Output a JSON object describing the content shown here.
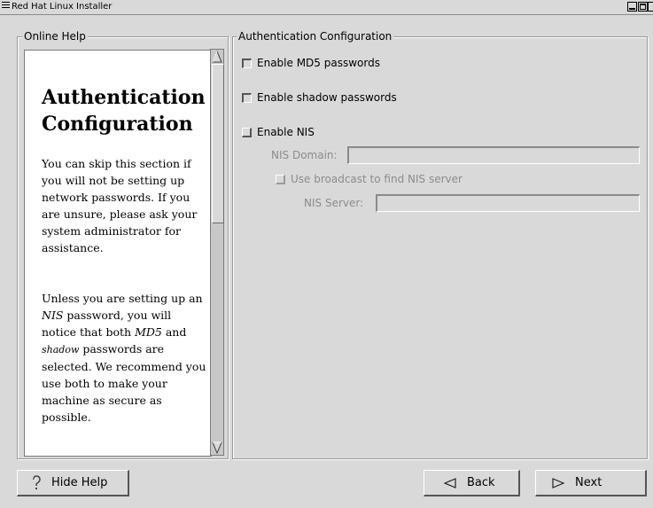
{
  "window": {
    "title": "Red Hat Linux Installer"
  },
  "help": {
    "frame_label": "Online Help",
    "heading": "Authentication Configuration",
    "para1": "You can skip this section if you will not be setting up network passwords. If you are unsure, please ask your system administrator for assistance.",
    "para2_a": "Unless you are setting up an ",
    "para2_nis": "NIS",
    "para2_b": " password, you will notice that both ",
    "para2_md5": "MD5",
    "para2_c": " and ",
    "para2_shadow": "shadow",
    "para2_d": " passwords are selected. We recommend you use both to make your machine as secure as possible."
  },
  "auth": {
    "frame_label": "Authentication Configuration",
    "md5": {
      "label": "Enable MD5 passwords",
      "checked": true
    },
    "shadow": {
      "label": "Enable shadow passwords",
      "checked": true
    },
    "nis": {
      "label": "Enable NIS",
      "checked": false
    },
    "nis_domain_label": "NIS Domain:",
    "nis_domain_value": "",
    "broadcast": {
      "label": "Use broadcast to find NIS server",
      "checked": false
    },
    "nis_server_label": "NIS Server:",
    "nis_server_value": ""
  },
  "buttons": {
    "hide_help": "Hide Help",
    "back": "Back",
    "next": "Next"
  }
}
